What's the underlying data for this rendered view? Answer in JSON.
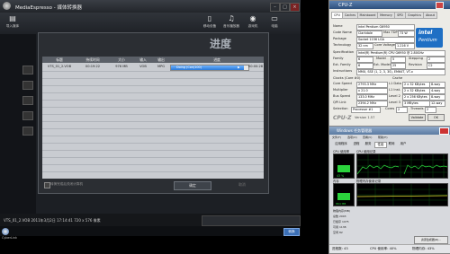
{
  "app": {
    "title": "MediaEspresso - 媒体转换器",
    "toolbar": [
      {
        "label": "导入媒体",
        "icon": "import-icon"
      },
      {
        "label": "移动设备",
        "icon": "mobile-icon"
      },
      {
        "label": "音乐播放器",
        "icon": "music-player-icon"
      },
      {
        "label": "游戏机",
        "icon": "game-console-icon"
      },
      {
        "label": "电脑",
        "icon": "computer-icon"
      }
    ],
    "window_controls": {
      "min": "–",
      "max": "□",
      "close": "×"
    },
    "status_text": "VTS_01_2.VOB  2011年3月2日 17:14:41  720 x 576 像素",
    "bottom_button": "转换",
    "brand": "CyberLink"
  },
  "dialog": {
    "title": "进度",
    "columns": [
      "标题",
      "持续时间",
      "大小",
      "输入",
      "输出",
      "进度"
    ],
    "rows": [
      {
        "title": "VTS_01_2.VOB",
        "duration": "00:19:22",
        "size": "976 MB",
        "input": "VOB",
        "output": "MPG",
        "status": "Doing (Con(100)",
        "progress": 0.94,
        "elapsed": "00:00:28"
      }
    ],
    "checkbox_label": "转换完成后关闭计算机",
    "ok": "确定",
    "cancel": "取消"
  },
  "cpuz": {
    "title": "CPU-Z",
    "tabs": [
      "CPU",
      "Caches",
      "Mainboard",
      "Memory",
      "SPD",
      "Graphics",
      "About"
    ],
    "processor": {
      "Name": "Intel Pentium G6950",
      "Code Name": "Clarkdale",
      "Max TDP": "73 W",
      "Package": "Socket 1156 LGA",
      "Technology": "32 nm",
      "Core Voltage": "1.216 V",
      "Specification": "Intel(R) Pentium(R) CPU  G6950 @ 2.80GHz",
      "Family": "6",
      "Model": "5",
      "Stepping": "2",
      "Ext. Family": "6",
      "Ext. Model": "25",
      "Revision": "C2",
      "Instructions": "MMX, SSE (1, 2, 3, 3S), EM64T, VT-x"
    },
    "clocks": {
      "Core Speed": "2793.3 MHz",
      "Multiplier": "x 21.0",
      "Bus Speed": "133.0 MHz",
      "QPI Link": "2394.2 MHz"
    },
    "cache": {
      "L1 Data": "2 x 32 KBytes",
      "L1 Data Way": "8-way",
      "L1 Inst.": "2 x 32 KBytes",
      "L1 Inst. Way": "4-way",
      "Level 2": "2 x 256 KBytes",
      "Level 2 Way": "8-way",
      "Level 3": "3 MBytes",
      "Level 3 Way": "12-way"
    },
    "selection": "Processor #1",
    "cores_label": "Cores",
    "cores": "2",
    "threads_label": "Threads",
    "threads": "2",
    "logo": "CPU-Z",
    "version": "Version 1.57",
    "validate": "Validate",
    "ok": "OK",
    "intel_badge": {
      "brand": "intel",
      "product": "Pentium"
    }
  },
  "taskmgr": {
    "title": "Windows 任务管理器",
    "menu": [
      "文件(F)",
      "选项(O)",
      "查看(V)",
      "帮助(H)"
    ],
    "tabs": [
      "应用程序",
      "进程",
      "服务",
      "性能",
      "联网",
      "用户"
    ],
    "cpu_usage_label": "CPU 使用率",
    "cpu_history_label": "CPU 使用记录",
    "cpu_usage_pct": 43,
    "cpu_usage_text": "43 %",
    "mem_label": "内存",
    "mem_history_label": "物理内存使用记录",
    "mem_text": "864 MB",
    "stats": [
      "物理内存(MB)",
      "总数  2003",
      "已缓存  1075",
      "可用  1138",
      "空闲  82"
    ],
    "status": {
      "processes": "进程数: 43",
      "cpu": "CPU 使用率: 40%",
      "mem": "物理内存: 43%"
    }
  },
  "colors": {
    "accent_blue": "#2a79d8",
    "graph_green": "#2bd33c"
  }
}
